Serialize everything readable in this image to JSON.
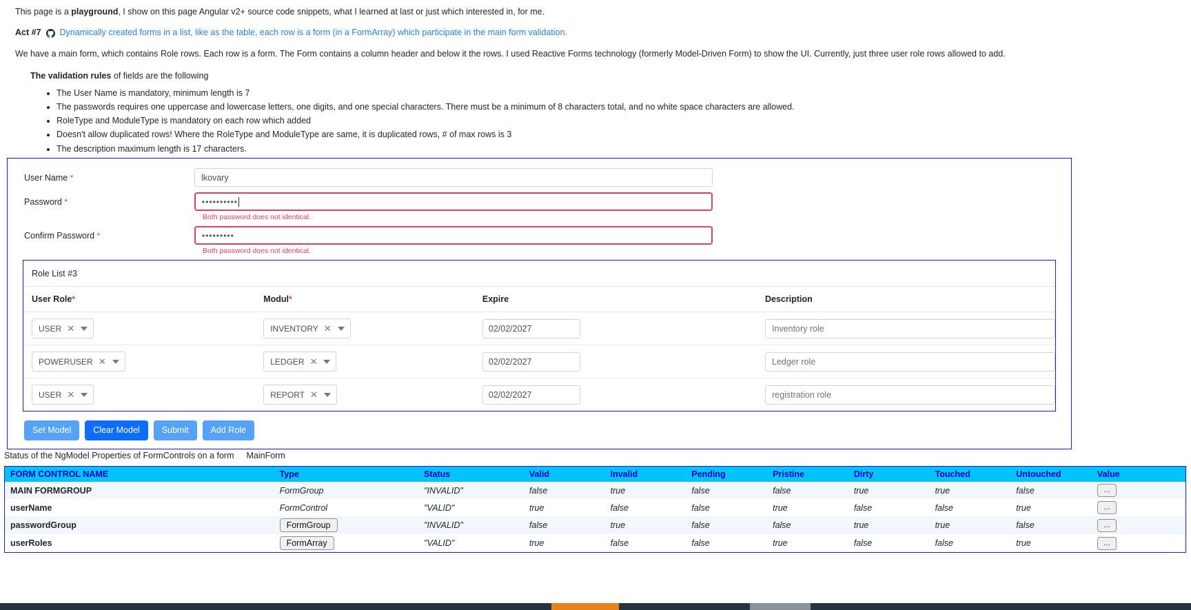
{
  "intro": {
    "lead_pre": "This page is a ",
    "lead_bold": "playground",
    "lead_post": ", I show on this page Angular v2+ source code snippets, what I learned at last or just which interested in, for me.",
    "act_label": "Act #7",
    "act_icon": "github-icon",
    "act_link": "Dynamically created forms in a list, like as the table, each row is a form (in a FormArray) which participate in the main form validation.",
    "paragraph": "We have a main form, which contains Role rows. Each row is a form. The Form contains a column header and below it the rows. I used Reactive Forms technology (formerly Model-Driven Form) to show the UI. Currently, just three user role rows allowed to add.",
    "rules_title_bold": "The validation rules",
    "rules_title_rest": " of fields are the following",
    "rules": [
      "The User Name is mandatory, minimum length is 7",
      "The passwords requires one uppercase and lowercase letters, one digits, and one special characters. There must be a minimum of 8 characters total, and no white space characters are allowed.",
      "RoleType and ModuleType is mandatory on each row which added",
      "Doesn't allow duplicated rows! Where the RoleType and ModuleType are same, it is duplicated rows, # of max rows is 3",
      "The description maximum length is 17 characters."
    ]
  },
  "form": {
    "username_label": "User Name",
    "username_value": "lkovary",
    "password_label": "Password",
    "password_value": "••••••••••",
    "password_error": "Both password does not identical.",
    "confirm_label": "Confirm Password",
    "confirm_value": "•••••••••",
    "confirm_error": "Both password does not identical.",
    "required_mark": "*"
  },
  "role_list": {
    "title": "Role List #3",
    "columns": {
      "user_role": "User Role",
      "modul": "Modul",
      "expire": "Expire",
      "description": "Description",
      "required_mark": "*"
    },
    "rows": [
      {
        "role": "USER",
        "modul": "INVENTORY",
        "expire": "02/02/2027",
        "description": "Inventory role"
      },
      {
        "role": "POWERUSER",
        "modul": "LEDGER",
        "expire": "02/02/2027",
        "description": "Ledger role"
      },
      {
        "role": "USER",
        "modul": "REPORT",
        "expire": "02/02/2027",
        "description": "registration role"
      }
    ],
    "clear_icon": "close-icon",
    "dropdown_icon": "chevron-down-icon"
  },
  "buttons": {
    "set_model": "Set Model",
    "clear_model": "Clear Model",
    "submit": "Submit",
    "add_role": "Add Role"
  },
  "status": {
    "caption": "Status of the NgModel Properties of FormControls on a form",
    "form_name": "MainForm",
    "headers": [
      "FORM CONTROL NAME",
      "Type",
      "Status",
      "Valid",
      "Invalid",
      "Pending",
      "Pristine",
      "Dirty",
      "Touched",
      "Untouched",
      "Value"
    ],
    "value_button": "...",
    "rows": [
      {
        "name": "MAIN FORMGROUP",
        "type": "FormGroup",
        "type_is_button": false,
        "status": "\"INVALID\"",
        "valid": "false",
        "invalid": "true",
        "pending": "false",
        "pristine": "false",
        "dirty": "true",
        "touched": "true",
        "untouched": "false"
      },
      {
        "name": "userName",
        "type": "FormControl",
        "type_is_button": false,
        "status": "\"VALID\"",
        "valid": "true",
        "invalid": "false",
        "pending": "false",
        "pristine": "true",
        "dirty": "false",
        "touched": "false",
        "untouched": "true"
      },
      {
        "name": "passwordGroup",
        "type": "FormGroup",
        "type_is_button": true,
        "status": "\"INVALID\"",
        "valid": "false",
        "invalid": "true",
        "pending": "false",
        "pristine": "false",
        "dirty": "true",
        "touched": "true",
        "untouched": "false"
      },
      {
        "name": "userRoles",
        "type": "FormArray",
        "type_is_button": true,
        "status": "\"VALID\"",
        "valid": "true",
        "invalid": "false",
        "pending": "false",
        "pristine": "true",
        "dirty": "false",
        "touched": "false",
        "untouched": "true"
      }
    ]
  },
  "colors": {
    "accent_blue": "#1a1ae6",
    "header_cyan": "#00c3ff",
    "header_text": "#0000c8",
    "btn_blue": "#54a3f7",
    "btn_active_blue": "#0d6efd",
    "error_red": "#e4405a",
    "true_green": "#1a7a2e",
    "false_red": "#cf2430",
    "footer_dark": "#243441"
  }
}
